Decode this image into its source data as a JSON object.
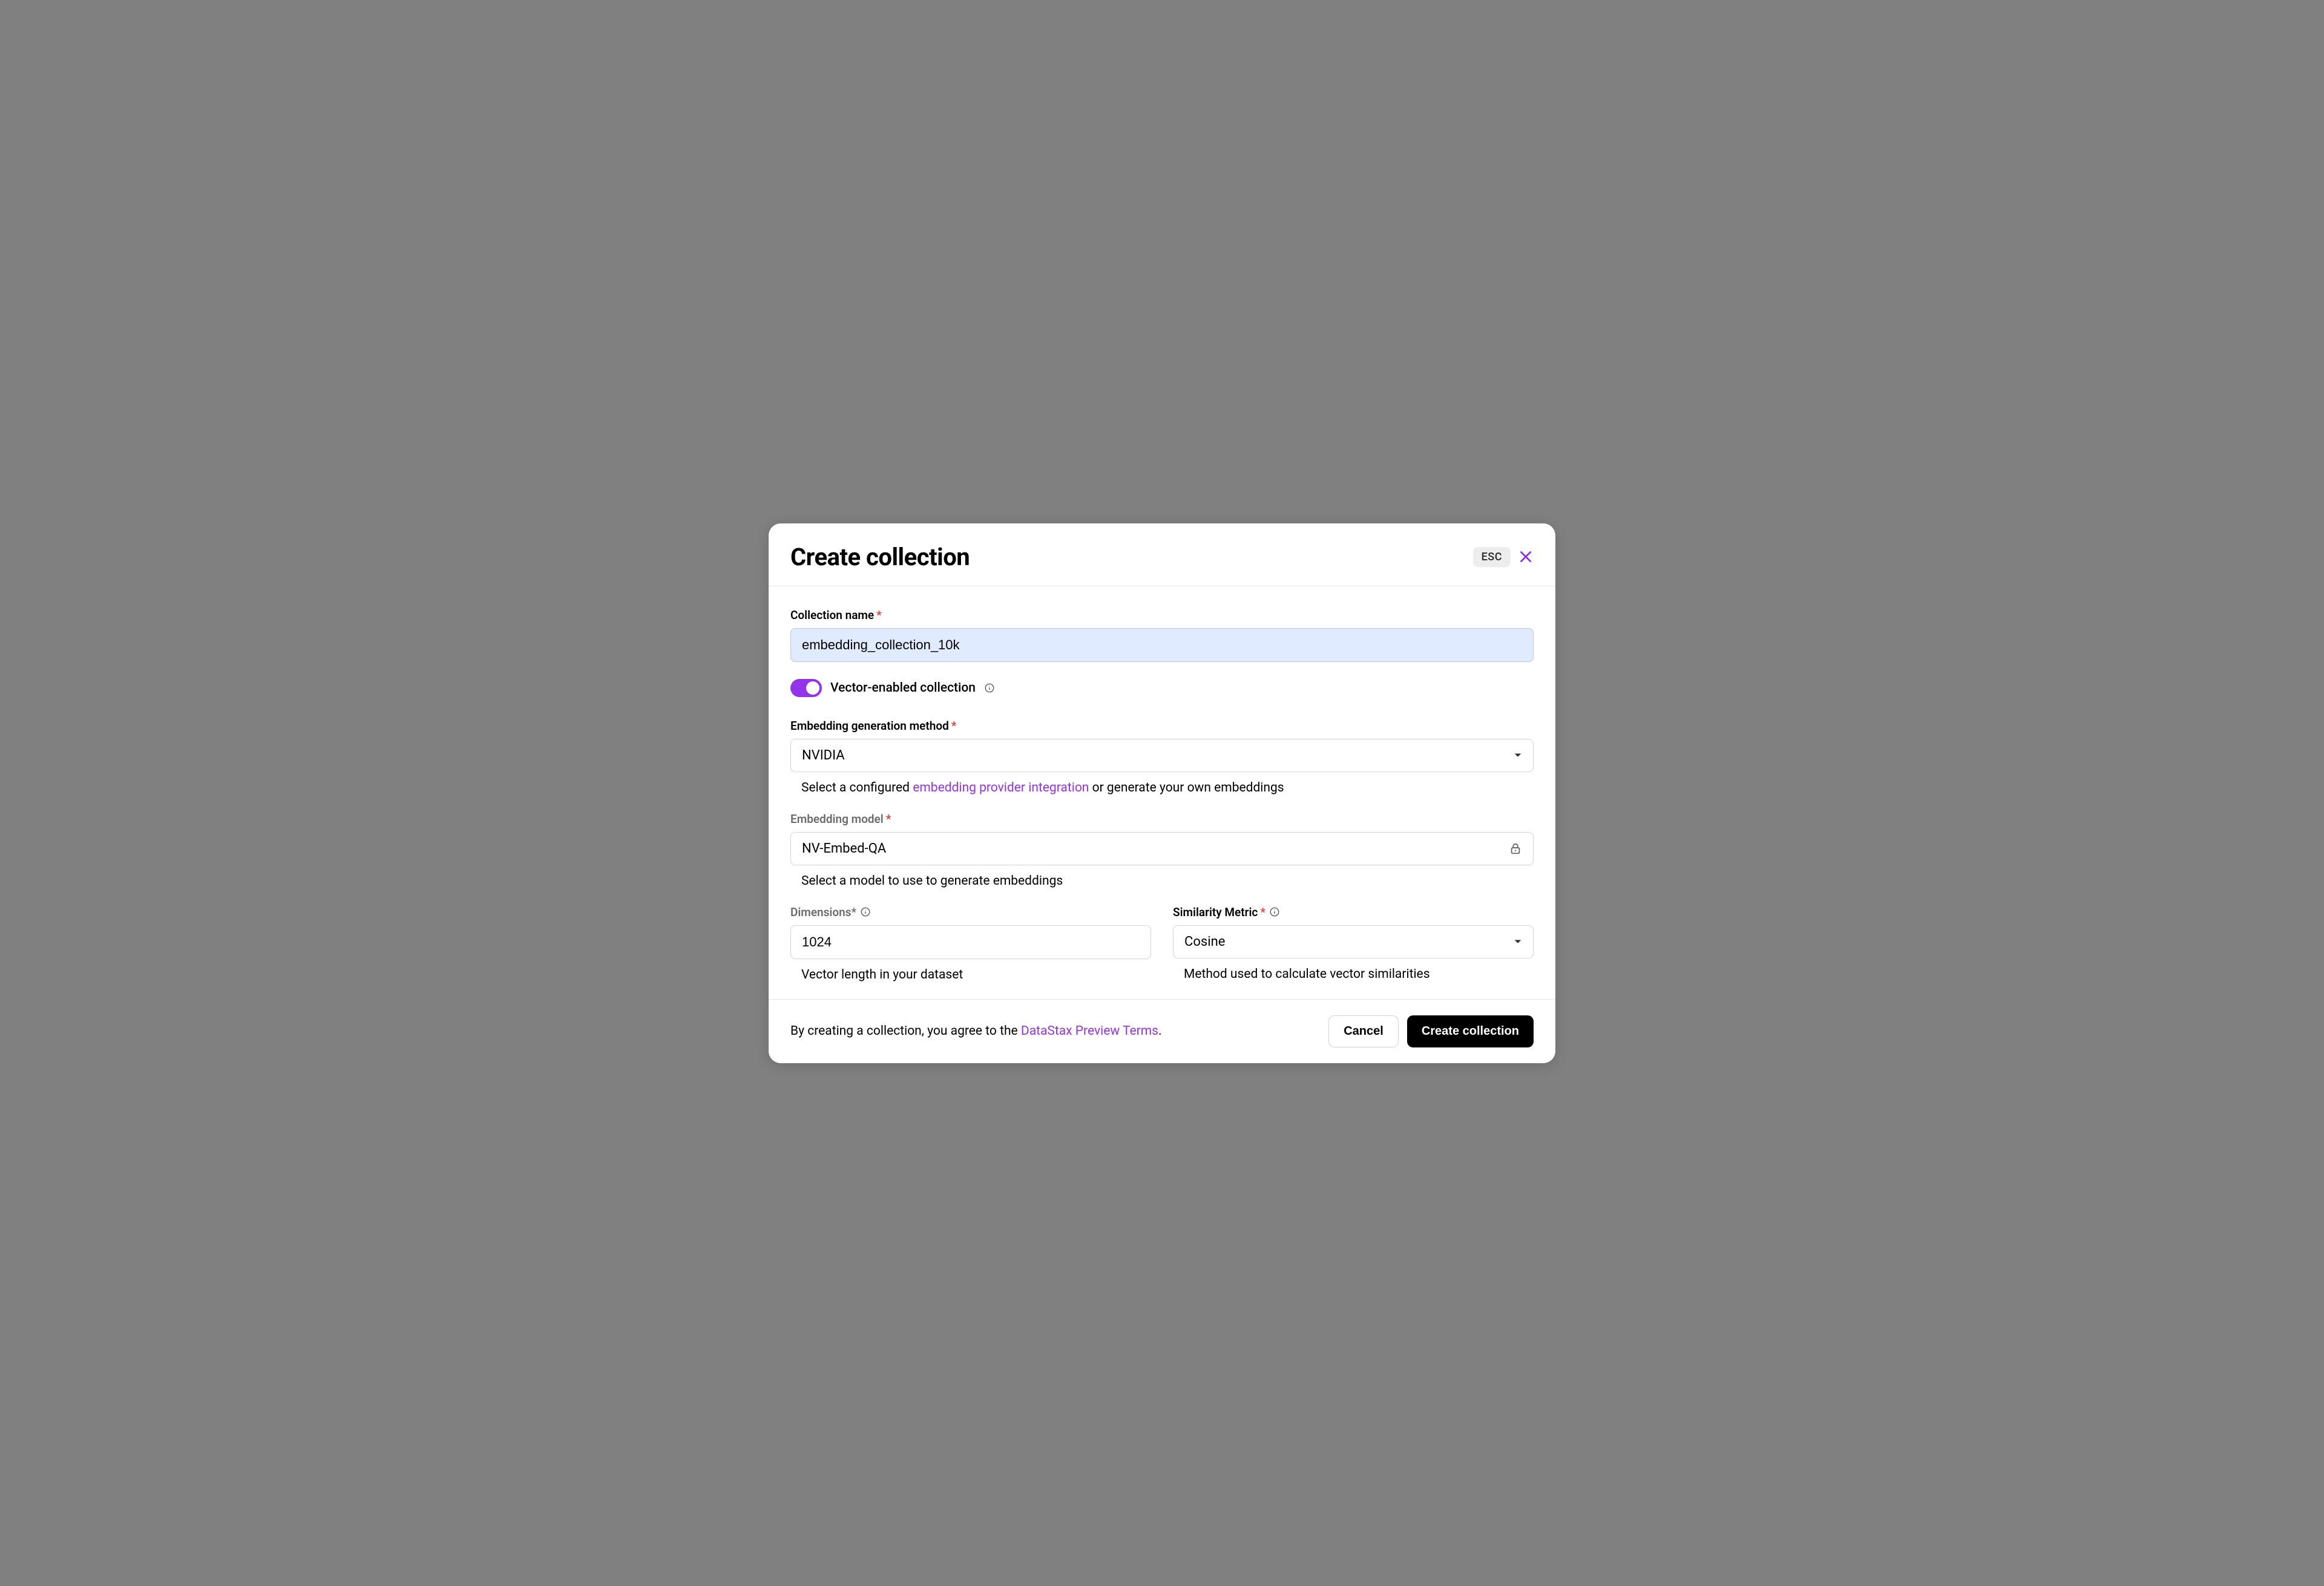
{
  "header": {
    "title": "Create collection",
    "esc_label": "ESC"
  },
  "collection_name": {
    "label": "Collection name",
    "value": "embedding_collection_10k"
  },
  "vector_toggle": {
    "label": "Vector-enabled collection",
    "on": true
  },
  "embedding_method": {
    "label": "Embedding generation method",
    "selected": "NVIDIA",
    "helper_prefix": "Select a configured ",
    "helper_link": "embedding provider integration",
    "helper_suffix": " or generate your own embeddings"
  },
  "embedding_model": {
    "label": "Embedding model",
    "selected": "NV-Embed-QA",
    "helper": "Select a model to use to generate embeddings",
    "locked": true
  },
  "dimensions": {
    "label": "Dimensions*",
    "value": "1024",
    "helper": "Vector length in your dataset"
  },
  "similarity": {
    "label": "Similarity Metric",
    "selected": "Cosine",
    "helper": "Method used to calculate vector similarities"
  },
  "footer": {
    "terms_prefix": "By creating a collection, you agree to the ",
    "terms_link": "DataStax Preview Terms",
    "terms_suffix": ".",
    "cancel_label": "Cancel",
    "submit_label": "Create collection"
  }
}
